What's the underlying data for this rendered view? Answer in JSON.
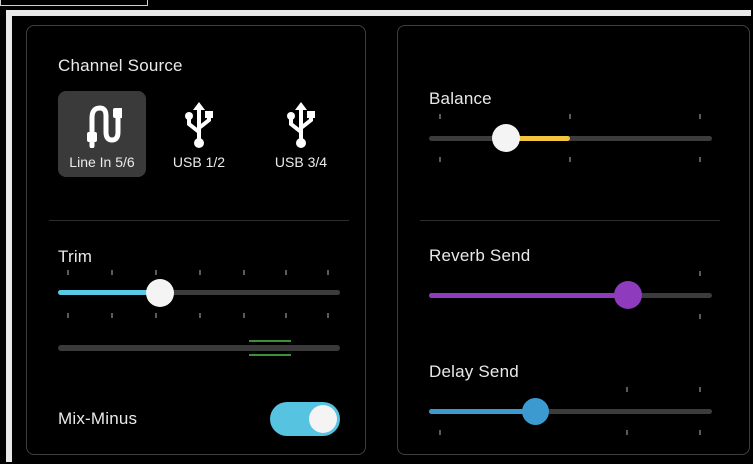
{
  "channel_source": {
    "title": "Channel Source",
    "options": [
      {
        "label": "Line In 5/6",
        "icon": "cable-icon",
        "selected": true
      },
      {
        "label": "USB 1/2",
        "icon": "usb-icon",
        "selected": false
      },
      {
        "label": "USB 3/4",
        "icon": "usb-icon",
        "selected": false
      }
    ]
  },
  "trim": {
    "title": "Trim",
    "value_fraction": 0.36,
    "accent": "#5bc8e5"
  },
  "meter": {
    "marker_color": "#3f8f3a"
  },
  "mix_minus": {
    "title": "Mix-Minus",
    "on": true,
    "accent": "#56c3e1"
  },
  "balance": {
    "title": "Balance",
    "value_fraction": 0.27,
    "accent": "#f2c53d"
  },
  "reverb_send": {
    "title": "Reverb Send",
    "value_fraction": 0.71,
    "accent": "#8f3bbd"
  },
  "delay_send": {
    "title": "Delay Send",
    "value_fraction": 0.38,
    "accent": "#3c9ad1"
  }
}
